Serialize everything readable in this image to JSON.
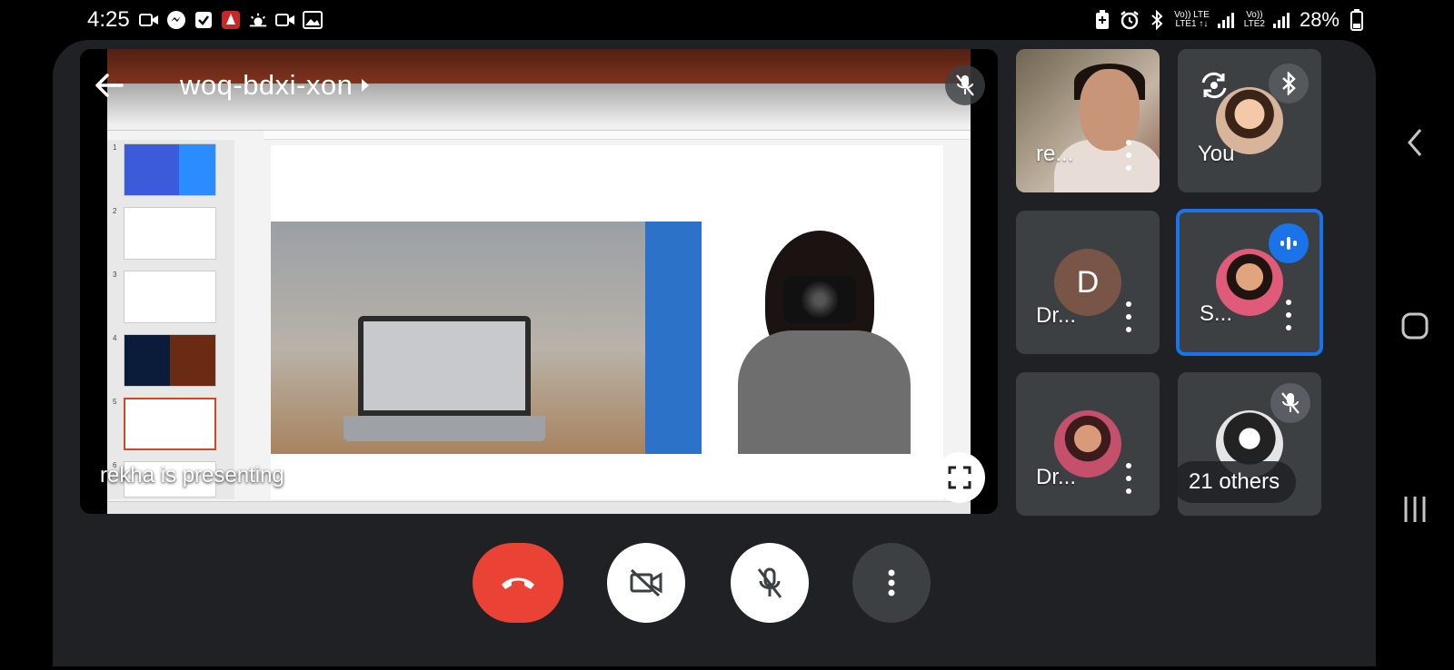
{
  "status_bar": {
    "time": "4:25",
    "left_icons": [
      "video-call-icon",
      "messenger-icon",
      "checkbox-icon",
      "app-icon",
      "weather-icon",
      "video-icon",
      "gallery-icon"
    ],
    "network_1_top": "Vo)) LTE",
    "network_1_bottom": "LTE1 ↑↓",
    "network_2_top": "Vo))",
    "network_2_bottom": "LTE2",
    "battery": "28%"
  },
  "presentation": {
    "meeting_code": "woq-bdxi-xon",
    "presenter_label": "rekha is presenting",
    "ppt": {
      "thumb_numbers": [
        "1",
        "2",
        "3",
        "4",
        "5",
        "6"
      ]
    }
  },
  "participants": [
    {
      "name": "re...",
      "type": "video"
    },
    {
      "name": "You",
      "type": "self"
    },
    {
      "name": "Dr...",
      "initial": "D",
      "type": "initial"
    },
    {
      "name": "S...",
      "type": "photo",
      "speaking": true
    },
    {
      "name": "Dr...",
      "type": "photo"
    },
    {
      "name": "21 others",
      "type": "others",
      "muted": true
    }
  ],
  "colors": {
    "background": "#202124",
    "end_call": "#ea4335",
    "active_speaker": "#1a73e8",
    "tile": "#3c4043"
  }
}
